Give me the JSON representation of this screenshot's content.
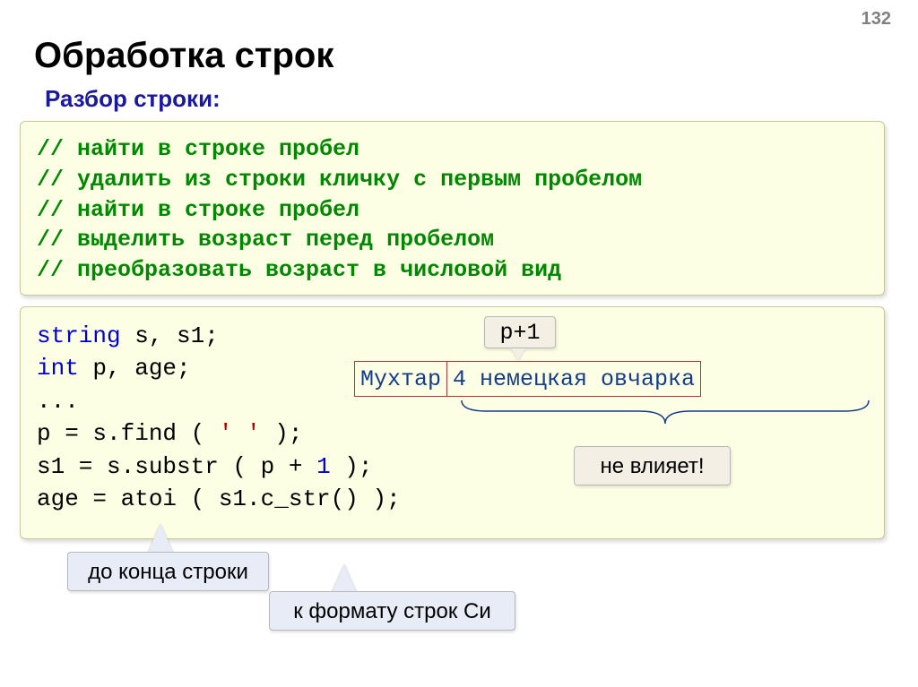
{
  "page_number": "132",
  "title": "Обработка строк",
  "subtitle": "Разбор строки:",
  "comments": {
    "l1": "// найти в строке пробел",
    "l2": "// удалить из строки кличку с первым пробелом",
    "l3": "// найти в строке пробел",
    "l4": "// выделить возраст перед пробелом",
    "l5": "// преобразовать возраст в числовой вид"
  },
  "code": {
    "kw_string": "string",
    "decl_s": " s, s1;",
    "kw_int": "int",
    "decl_p": " p, age;",
    "dots": "...",
    "line4a": "p = s.find ( ",
    "char_lit": "' '",
    "line4b": " );",
    "line5a": "s1 = s.substr ( p + ",
    "one": "1",
    "line5b": " );",
    "line6": "age = atoi ( s1.c_str() );"
  },
  "diagram": {
    "plus1": "p+1",
    "seg_left": "Мухтар",
    "seg_right": "4 немецкая овчарка",
    "no_effect": "не влияет!"
  },
  "callouts": {
    "c1": "до конца строки",
    "c2": "к формату строк Си"
  }
}
